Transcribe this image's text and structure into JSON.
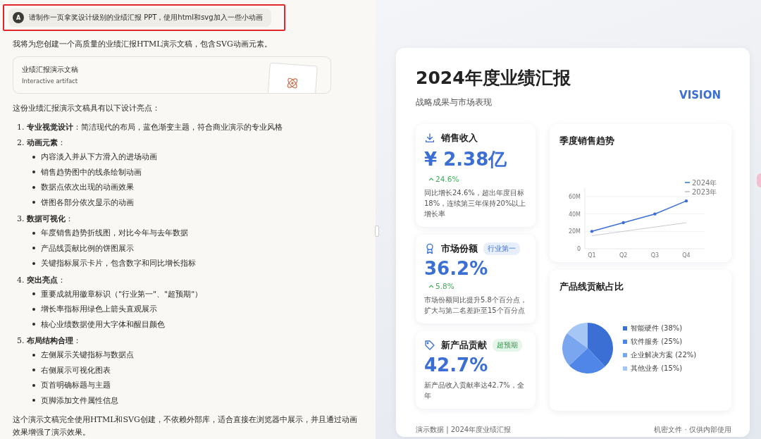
{
  "chat": {
    "user_message": {
      "avatar": "A",
      "text": "请制作一页拿奖设计级别的业绩汇报 PPT，使用html和svg加入一些小动画",
      "highlighted": true
    },
    "intro": "我将为您创建一个高质量的业绩汇报HTML演示文稿，包含SVG动画元素。",
    "artifact": {
      "title": "业绩汇报演示文稿",
      "subtitle": "Interactive artifact"
    },
    "lead": "这份业绩汇报演示文稿具有以下设计亮点：",
    "points": [
      {
        "number": "1.",
        "title": "专业视觉设计",
        "text": "：简洁现代的布局，蓝色渐变主题，符合商业演示的专业风格"
      },
      {
        "number": "2.",
        "title": "动画元素",
        "text": "：",
        "bullets": [
          "内容淡入并从下方滑入的进场动画",
          "销售趋势图中的线条绘制动画",
          "数据点依次出现的动画效果",
          "饼图各部分依次显示的动画"
        ]
      },
      {
        "number": "3.",
        "title": "数据可视化",
        "text": "：",
        "bullets": [
          "年度销售趋势折线图，对比今年与去年数据",
          "产品线贡献比例的饼图展示",
          "关键指标展示卡片，包含数字和同比增长指标"
        ]
      },
      {
        "number": "4.",
        "title": "突出亮点",
        "text": "：",
        "bullets": [
          "重要成就用徽章标识（\"行业第一\"、\"超预期\"）",
          "增长率指标用绿色上箭头直观展示",
          "核心业绩数据使用大字体和醒目颜色"
        ]
      },
      {
        "number": "5.",
        "title": "布局结构合理",
        "text": "：",
        "bullets": [
          "左侧展示关键指标与数据点",
          "右侧展示可视化图表",
          "页首明确标题与主题",
          "页脚添加文件属性信息"
        ]
      }
    ],
    "closing": "这个演示文稿完全使用HTML和SVG创建，不依赖外部库，适合直接在浏览器中展示，并且通过动画效果增强了演示效果。"
  },
  "slide": {
    "title": "2024年度业绩汇报",
    "subtitle": "战略成果与市场表现",
    "brand": "VISION",
    "metrics": [
      {
        "kind": "download",
        "title": "销售收入",
        "value": "¥ 2.38亿",
        "change": "24.6%",
        "text": "同比增长24.6%，超出年度目标18%，连续第三年保持20%以上增长率"
      },
      {
        "kind": "award",
        "title": "市场份额",
        "badge": {
          "text": "行业第一",
          "kind": "info"
        },
        "value": "36.2%",
        "change": "5.8%",
        "text": "市场份额同比提升5.8个百分点，扩大与第二名差距至15个百分点"
      },
      {
        "kind": "tag",
        "title": "新产品贡献",
        "badge": {
          "text": "超预期",
          "kind": "success"
        },
        "value": "42.7%",
        "text": "新产品收入贡献率达42.7%，全年"
      }
    ],
    "trend": {
      "title": "季度销售趋势",
      "chart_data": {
        "type": "line",
        "legend": "top-right",
        "categories": [
          "Q1",
          "Q2",
          "Q3",
          "Q4"
        ],
        "ylim": [
          0,
          60
        ],
        "yticks": [
          {
            "value": 0,
            "label": "0"
          },
          {
            "value": 20,
            "label": "20M"
          },
          {
            "value": 40,
            "label": "40M"
          },
          {
            "value": 60,
            "label": "60M"
          }
        ],
        "series": [
          {
            "name": "2024年",
            "color": "#3b6fd4",
            "values": [
              20,
              30,
              40,
              55
            ]
          },
          {
            "name": "2023年",
            "color": "#b8bcc4",
            "values": [
              15,
              20,
              25,
              30
            ]
          }
        ]
      }
    },
    "share": {
      "title": "产品线贡献占比",
      "chart_data": {
        "type": "pie",
        "legend": "right",
        "categories": [
          "智能硬件 (38%)",
          "软件服务 (25%)",
          "企业解决方案 (22%)",
          "其他业务 (15%)"
        ],
        "values": [
          38,
          25,
          22,
          15
        ],
        "colors": [
          "#3b6fd4",
          "#4f86e8",
          "#79a6ee",
          "#a6c6f5"
        ]
      }
    },
    "footer_left": "演示数据 | 2024年度业绩汇报",
    "footer_right": "机密文件 · 仅供内部使用"
  }
}
